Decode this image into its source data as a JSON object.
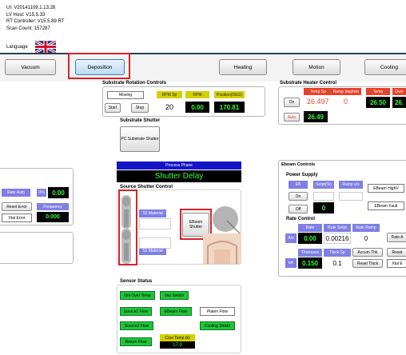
{
  "info": {
    "ui": "UI: V20141109.1.13.28",
    "lv_host": "LV Host: V15.5.33",
    "rt": "RT Controller: V15.5.89 RT",
    "scan": "Scan Count: 157287",
    "language_label": "Language"
  },
  "tabs": [
    "Vacuum",
    "Deposition",
    "Heating",
    "Motion",
    "Cooling"
  ],
  "substrate_rotation": {
    "title": "Substrate Rotation Controls",
    "status": "Moving",
    "headers": [
      "RPM Sp",
      "RPM",
      "Position(DEG)"
    ],
    "start": "Start",
    "stop": "Stop",
    "rpm_sp": "20",
    "rpm": "0.00",
    "position": "170.81"
  },
  "substrate_heater": {
    "title": "Substrate Heater Control",
    "headers": [
      "Temp Sp",
      "Ramp deg/min",
      "Temp",
      "Over"
    ],
    "on": "On",
    "auto": "Auto",
    "temp_sp": "26.497",
    "ramp": "0",
    "temp": "26.50",
    "over": "26.",
    "output": "26.49"
  },
  "substrate_shutter": {
    "title": "Substrate Shutter",
    "button": "PC Substrate Shutter"
  },
  "process_phase": {
    "label": "Process Phase",
    "value": "Shutter Delay"
  },
  "source_shutter": {
    "title": "Source Shutter Control",
    "s2": "S2 Material",
    "s1": "S1 Material",
    "ebeam": "EBeam Shutter"
  },
  "left_panel": {
    "rate_auto": "Rate Auto",
    "pct": "0%",
    "pct_value": "0.00",
    "reset_error": "Reset Error",
    "frequency": "Frequency",
    "freq_value": "0.000",
    "xtal_error": "Xtal Error"
  },
  "ebeam_controls": {
    "title": "Ebeam Controls",
    "power_supply": "Power Supply",
    "eb": "EB",
    "setpt": "Setpt(%)",
    "ramp_us": "Ramp u/s",
    "hv": "EBeam HighV",
    "on": "On",
    "off": "Off",
    "setpt_val": "0",
    "fault": "EBeam Fault",
    "rate_control": "Rate Control",
    "rate": "Rate",
    "rate_setpt": "Rate Setpt",
    "rate_ramp": "Rate Ramp",
    "rate_auto": "Rate A",
    "as": "A/s",
    "rate_val": "0.00",
    "rate_setpt_val": "0.00216",
    "rate_ramp_val": "0",
    "thickness": "Thickness",
    "thick_sp": "Thick Sp",
    "accum_thk": "Accum Thk",
    "reset": "Reset",
    "ka": "kA",
    "thickness_val": "0.150",
    "thick_sp_val": "0.1",
    "reset_thick": "Reset Thick",
    "xtal": "Xtal E"
  },
  "sensor_status": {
    "title": "Sensor Status",
    "not_over_temp": "Not Over Temp",
    "vac_switch": "Vac Switch",
    "source1_flow": "Source1 Flow",
    "ebeam_flow": "EBeam Flow",
    "platen_flow": "Platen Flow",
    "source2_flow": "Source2 Flow",
    "cooling_shield": "Cooling Shield",
    "return_flow": "Return Flow",
    "cryo_temp_label": "Cryo Temp (k)",
    "cryo_temp": "17.9"
  }
}
